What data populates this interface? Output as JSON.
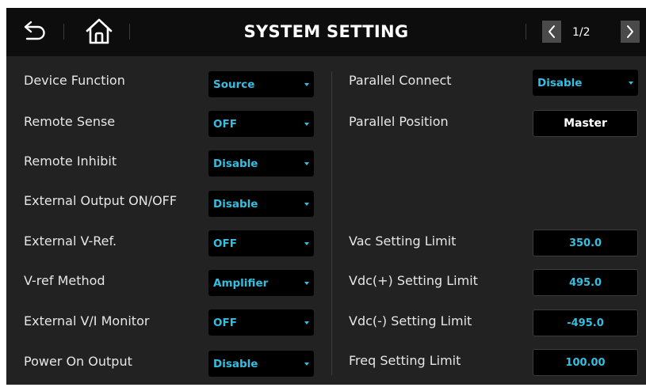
{
  "header": {
    "title": "SYSTEM SETTING",
    "page_indicator": "1/2",
    "icons": [
      "back-arrow-icon",
      "home-icon",
      "chevron-left-icon",
      "chevron-right-icon"
    ]
  },
  "left": {
    "rows": [
      {
        "label": "Device Function",
        "value": "Source"
      },
      {
        "label": "Remote Sense",
        "value": "OFF"
      },
      {
        "label": "Remote Inhibit",
        "value": "Disable"
      },
      {
        "label": "External Output ON/OFF",
        "value": "Disable"
      },
      {
        "label": "External V-Ref.",
        "value": "OFF"
      },
      {
        "label": "V-ref Method",
        "value": "Amplifier"
      },
      {
        "label": "External V/I Monitor",
        "value": "OFF"
      },
      {
        "label": "Power On Output",
        "value": "Disable"
      }
    ]
  },
  "right": {
    "parallel_connect": {
      "label": "Parallel Connect",
      "value": "Disable"
    },
    "parallel_position": {
      "label": "Parallel Position",
      "value": "Master"
    },
    "limits": [
      {
        "label": "Vac Setting Limit",
        "value": "350.0"
      },
      {
        "label": "Vdc(+) Setting Limit",
        "value": "495.0"
      },
      {
        "label": "Vdc(-) Setting Limit",
        "value": "-495.0"
      },
      {
        "label": "Freq Setting Limit",
        "value": "100.00"
      }
    ]
  },
  "colors": {
    "background": "#222222",
    "header": "#0d0d0d",
    "accent": "#34bfe0",
    "label_text": "#e6e6e6"
  }
}
